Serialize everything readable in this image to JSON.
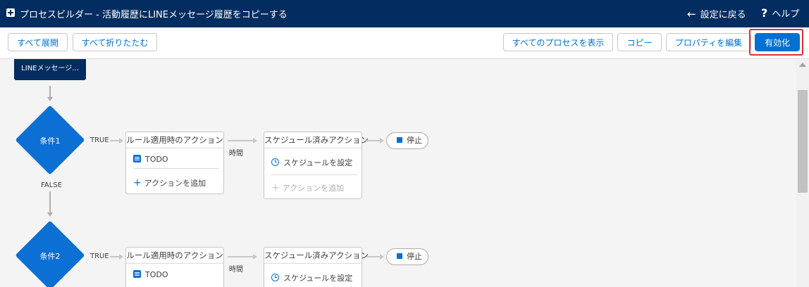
{
  "header": {
    "title": "プロセスビルダー - 活動履歴にLINEメッセージ履歴をコピーする",
    "back_label": "設定に戻る",
    "help_label": "ヘルプ"
  },
  "toolbar": {
    "expand_all": "すべて展開",
    "collapse_all": "すべて折りたたむ",
    "show_all_processes": "すべてのプロセスを表示",
    "copy": "コピー",
    "edit_properties": "プロパティを編集",
    "activate": "有効化"
  },
  "canvas": {
    "start_node": "LINEメッセージ...",
    "false_label": "FALSE",
    "conditions": [
      {
        "name": "条件1",
        "true_label": "TRUE",
        "immediate_header": "ルール適用時のアクション",
        "action": "TODO",
        "add_action": "アクションを追加",
        "time_label": "時間",
        "scheduled_header": "スケジュール済みアクション",
        "schedule_label": "スケジュールを設定",
        "scheduled_add_action": "アクションを追加",
        "stop_label": "停止"
      },
      {
        "name": "条件2",
        "true_label": "TRUE",
        "immediate_header": "ルール適用時のアクション",
        "action": "TODO",
        "time_label": "時間",
        "scheduled_header": "スケジュール済みアクション",
        "schedule_label": "スケジュールを設定",
        "stop_label": "停止"
      }
    ]
  },
  "colors": {
    "header_bg": "#032d60",
    "brand_blue": "#0070d2",
    "highlight": "#e03030"
  }
}
